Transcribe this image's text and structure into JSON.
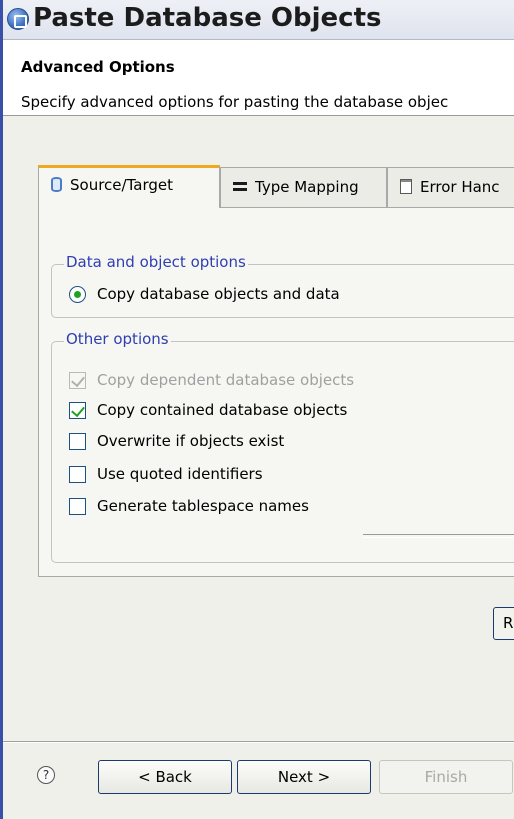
{
  "window": {
    "title": "Paste Database Objects"
  },
  "header": {
    "title": "Advanced Options",
    "description": "Specify advanced options for pasting the database objec"
  },
  "tabs": [
    {
      "label": "Source/Target",
      "icon": "database-icon",
      "active": true
    },
    {
      "label": "Type Mapping",
      "icon": "table-icon",
      "active": false
    },
    {
      "label": "Error Hanc",
      "icon": "page-icon",
      "active": false
    }
  ],
  "groups": {
    "data_options": {
      "legend": "Data and object options",
      "options": [
        {
          "label": "Copy database objects and data",
          "type": "radio",
          "checked": true
        }
      ]
    },
    "other_options": {
      "legend": "Other options",
      "options": [
        {
          "label": "Copy dependent database objects",
          "checked": true,
          "enabled": false
        },
        {
          "label": "Copy contained database objects",
          "checked": true,
          "enabled": true
        },
        {
          "label": "Overwrite if objects exist",
          "checked": false,
          "enabled": true
        },
        {
          "label": "Use quoted identifiers",
          "checked": false,
          "enabled": true
        },
        {
          "label": "Generate tablespace names",
          "checked": false,
          "enabled": true
        }
      ]
    }
  },
  "restore_button_label": "R",
  "footer": {
    "help_glyph": "?",
    "back_label": "< Back",
    "next_label": "Next >",
    "finish_label": "Finish",
    "finish_enabled": false
  },
  "colors": {
    "accent_tab": "#f0a81e",
    "legend_text": "#2f3fb0",
    "check_mark": "#21a121"
  }
}
